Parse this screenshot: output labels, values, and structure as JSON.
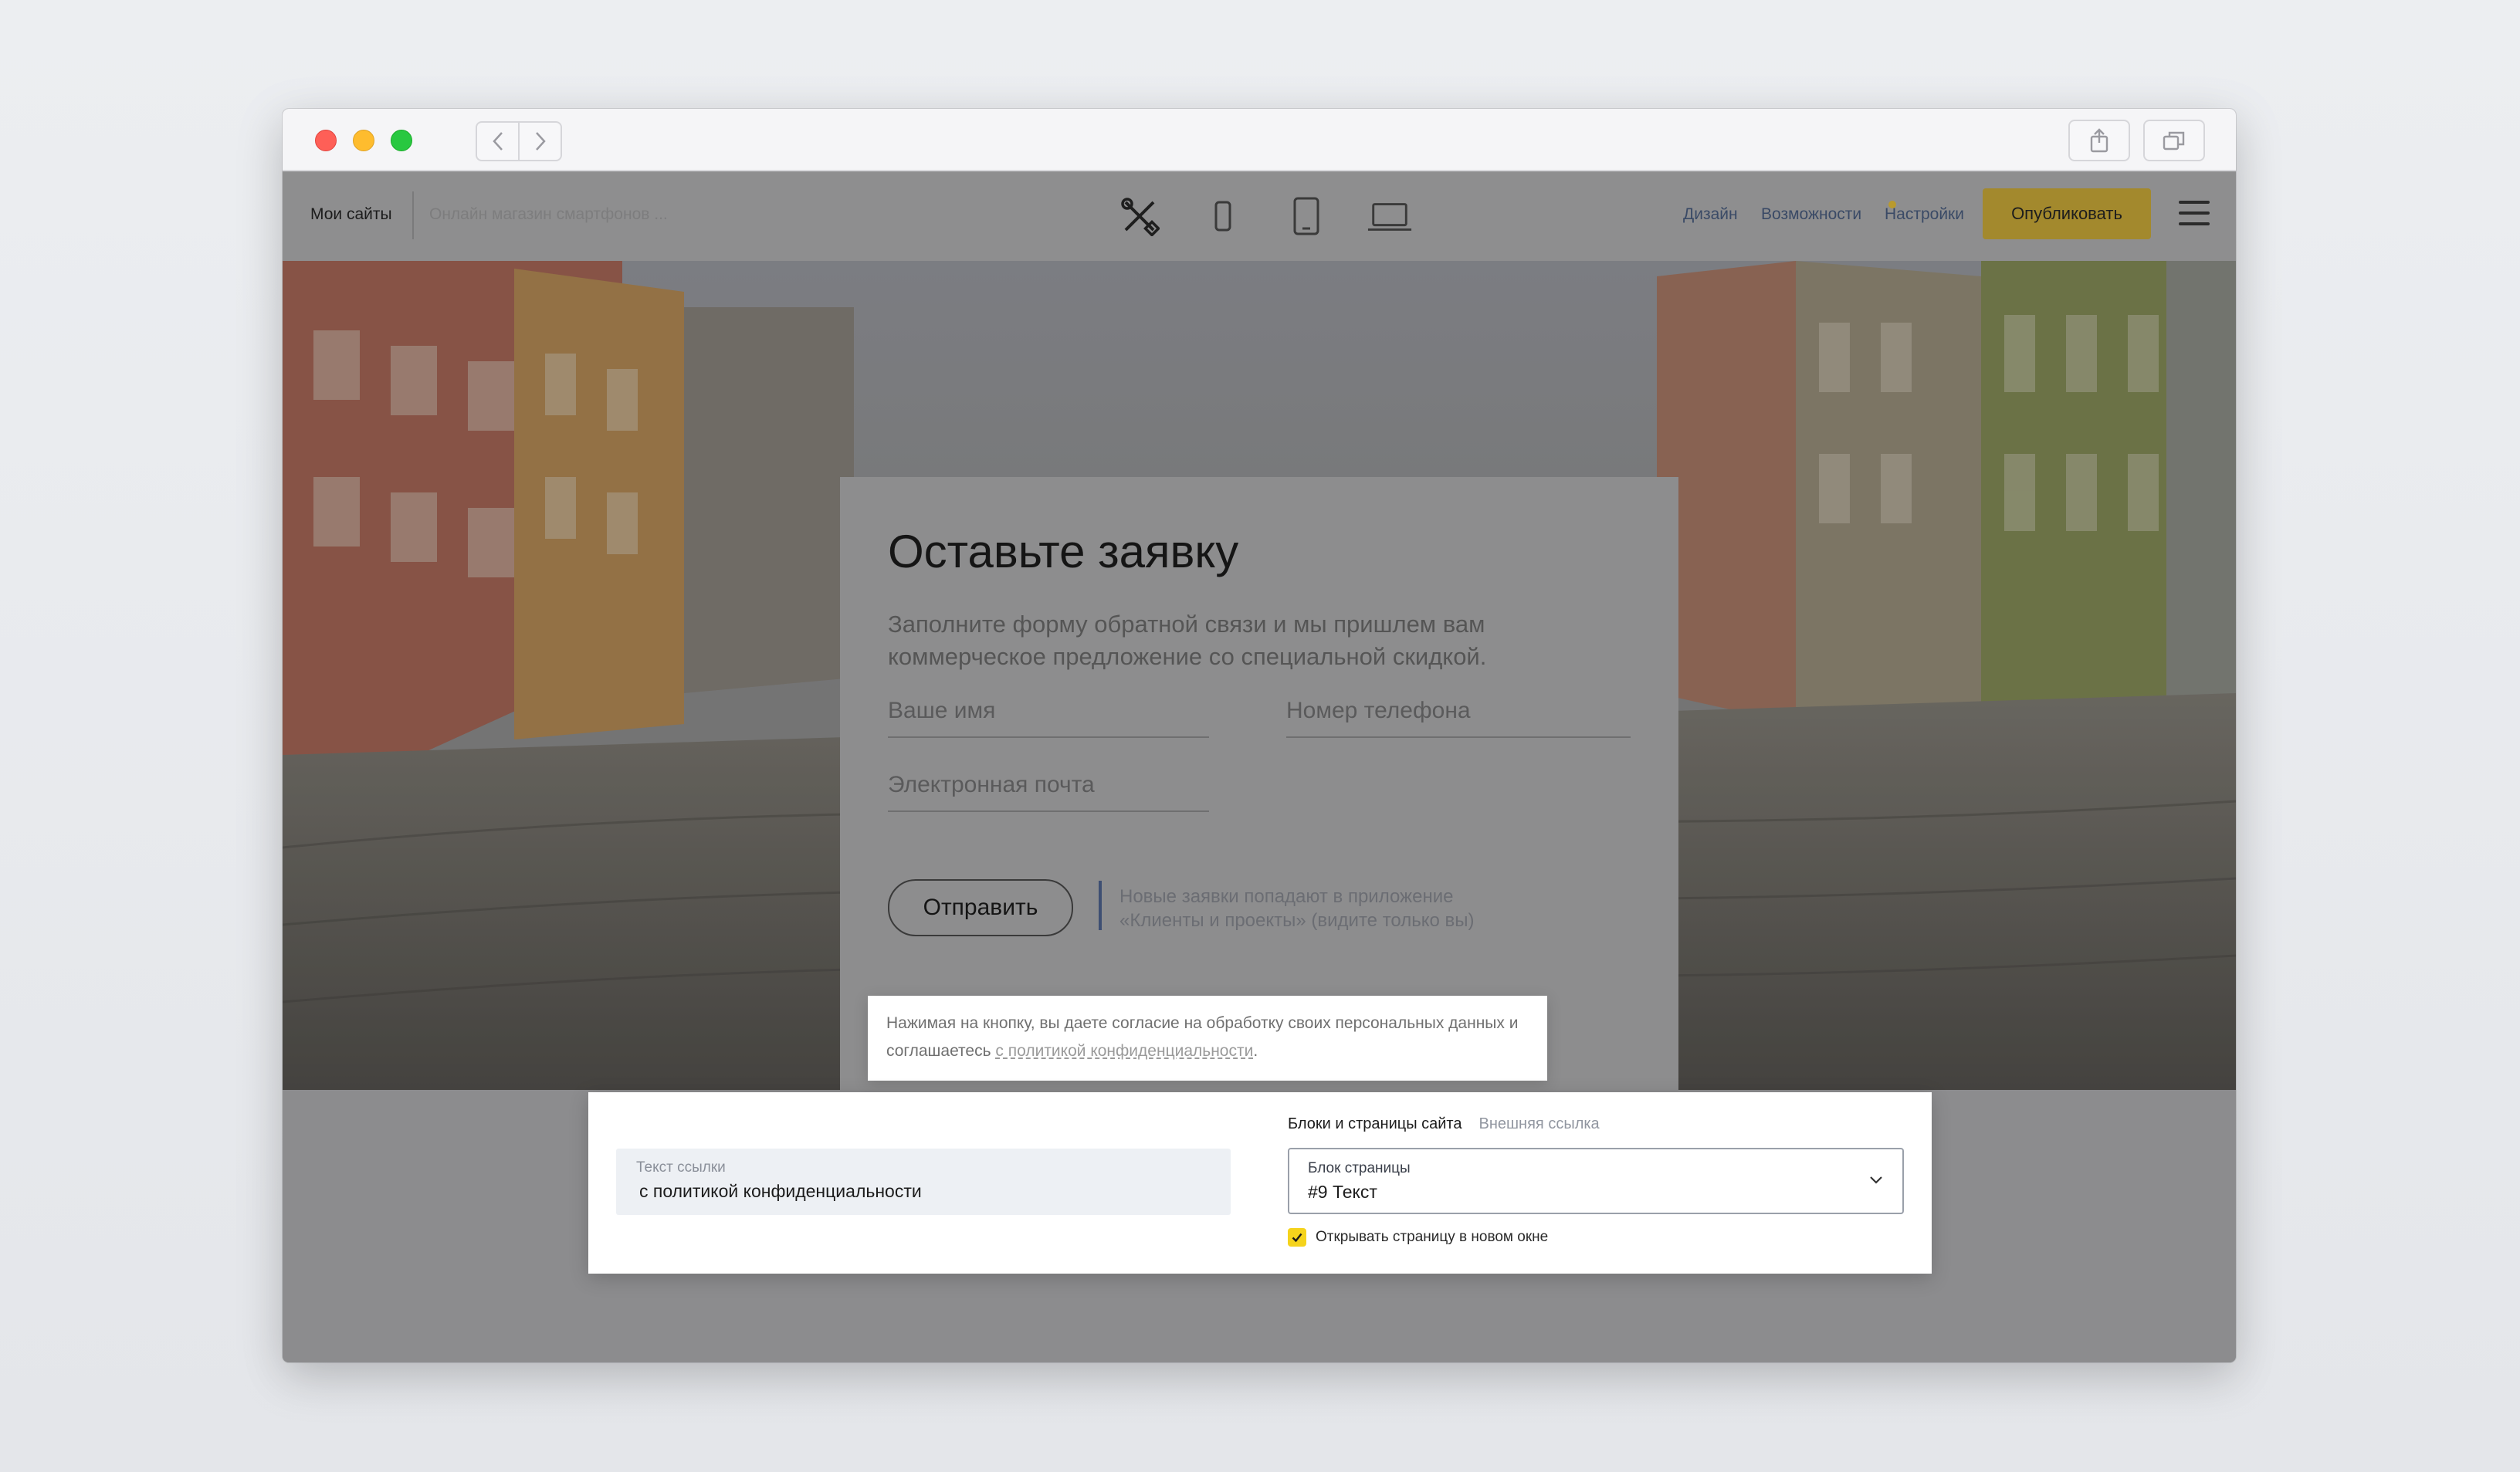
{
  "editor": {
    "my_sites": "Мои сайты",
    "site_name": "Онлайн магазин смартфонов ...",
    "nav": {
      "design": "Дизайн",
      "features": "Возможности",
      "settings": "Настройки"
    },
    "publish_label": "Опубликовать"
  },
  "form": {
    "title": "Оставьте заявку",
    "subtitle": "Заполните форму обратной связи и мы пришлем вам коммерческое предложение со специальной скидкой.",
    "name_placeholder": "Ваше имя",
    "phone_placeholder": "Номер телефона",
    "email_placeholder": "Электронная почта",
    "submit_label": "Отправить",
    "note": "Новые заявки попадают в приложение «Клиенты и проекты» (видите только вы)"
  },
  "consent": {
    "text": "Нажимая на кнопку, вы даете согласие на обработку своих персональных данных и соглашаетесь",
    "link_text": "с политикой конфиденциальности",
    "end": "."
  },
  "link_panel": {
    "text_label": "Текст ссылки",
    "text_value": "с политикой конфиденциальности",
    "tabs": [
      "Блоки и страницы сайта",
      "Внешняя ссылка"
    ],
    "select_label": "Блок страницы",
    "select_value": "#9 Текст",
    "open_new_window_label": "Открывать страницу в новом окне",
    "open_new_window_checked": true
  },
  "colors": {
    "accent": "#f5d31c",
    "publish_dimmed": "#a3892d",
    "link_blue": "#3a4a66"
  },
  "icons": [
    "back-arrow-icon",
    "forward-arrow-icon",
    "share-icon",
    "tabs-icon",
    "tools-icon",
    "phone-icon",
    "tablet-icon",
    "laptop-icon",
    "menu-icon",
    "chevron-down-icon",
    "checkmark-icon"
  ]
}
